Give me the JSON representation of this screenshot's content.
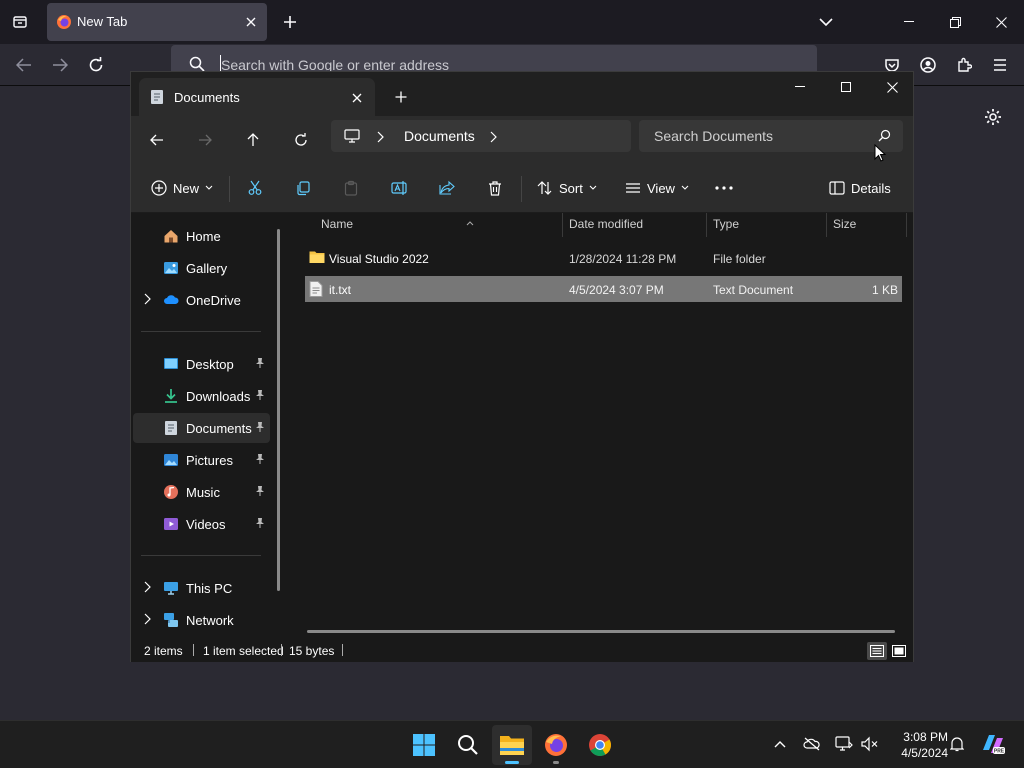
{
  "browser": {
    "tab_title": "New Tab",
    "url_placeholder": "Search with Google or enter address"
  },
  "explorer": {
    "tab_title": "Documents",
    "breadcrumb": [
      "Documents"
    ],
    "search_placeholder": "Search Documents",
    "toolbar": {
      "new_label": "New",
      "sort_label": "Sort",
      "view_label": "View",
      "details_label": "Details"
    },
    "nav": {
      "top": [
        {
          "label": "Home",
          "icon": "home-icon"
        },
        {
          "label": "Gallery",
          "icon": "gallery-icon"
        },
        {
          "label": "OneDrive",
          "icon": "onedrive-icon",
          "expandable": true
        }
      ],
      "pinned": [
        {
          "label": "Desktop",
          "icon": "desktop-icon"
        },
        {
          "label": "Downloads",
          "icon": "downloads-icon"
        },
        {
          "label": "Documents",
          "icon": "documents-icon",
          "selected": true
        },
        {
          "label": "Pictures",
          "icon": "pictures-icon"
        },
        {
          "label": "Music",
          "icon": "music-icon"
        },
        {
          "label": "Videos",
          "icon": "videos-icon"
        }
      ],
      "bottom": [
        {
          "label": "This PC",
          "icon": "this-pc-icon",
          "expandable": true
        },
        {
          "label": "Network",
          "icon": "network-icon",
          "expandable": true
        }
      ]
    },
    "columns": [
      "Name",
      "Date modified",
      "Type",
      "Size"
    ],
    "files": [
      {
        "name": "Visual Studio 2022",
        "date": "1/28/2024 11:28 PM",
        "type": "File folder",
        "size": "",
        "icon": "folder-icon",
        "selected": false
      },
      {
        "name": "it.txt",
        "date": "4/5/2024 3:07 PM",
        "type": "Text Document",
        "size": "1 KB",
        "icon": "text-file-icon",
        "selected": true
      }
    ],
    "status": {
      "items": "2 items",
      "selected": "1 item selected",
      "size": "15 bytes"
    }
  },
  "taskbar": {
    "apps": [
      "start-icon",
      "search-icon",
      "file-explorer-icon",
      "firefox-icon",
      "chrome-icon"
    ],
    "time": "3:08 PM",
    "date": "4/5/2024"
  },
  "colors": {
    "accent": "#4cc2ff",
    "folder": "#f4c344",
    "selection": "#777777"
  }
}
